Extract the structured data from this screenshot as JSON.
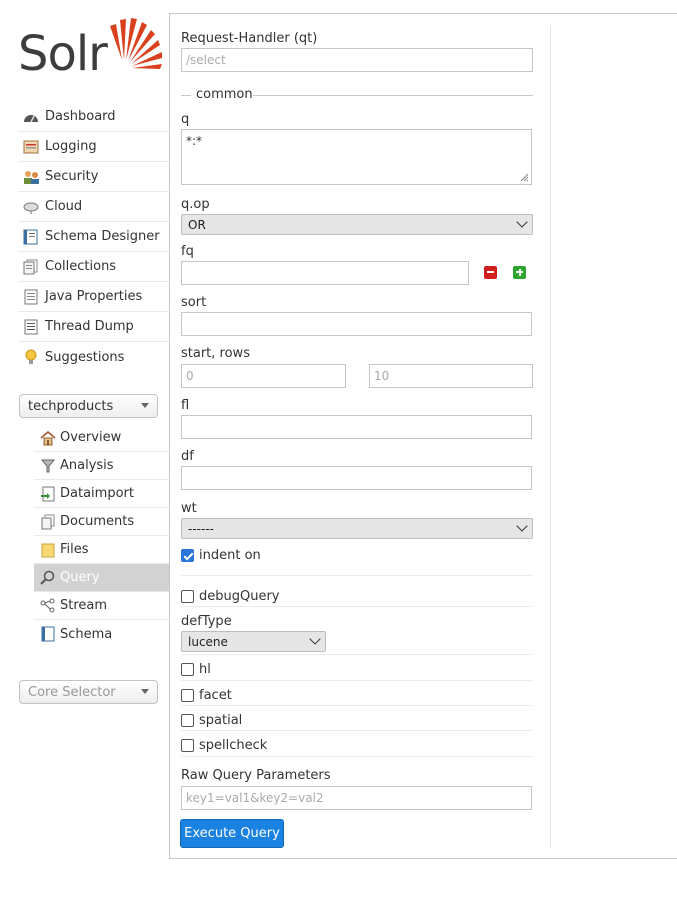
{
  "logo": {
    "text": "Solr"
  },
  "nav": [
    {
      "label": "Dashboard",
      "icon": "dashboard-icon"
    },
    {
      "label": "Logging",
      "icon": "logging-icon"
    },
    {
      "label": "Security",
      "icon": "security-icon"
    },
    {
      "label": "Cloud",
      "icon": "cloud-icon"
    },
    {
      "label": "Schema Designer",
      "icon": "schema-designer-icon"
    },
    {
      "label": "Collections",
      "icon": "collections-icon"
    },
    {
      "label": "Java Properties",
      "icon": "java-properties-icon"
    },
    {
      "label": "Thread Dump",
      "icon": "thread-dump-icon"
    },
    {
      "label": "Suggestions",
      "icon": "lightbulb-icon"
    }
  ],
  "core_dropdown": {
    "value": "techproducts"
  },
  "core_menu": [
    {
      "label": "Overview",
      "icon": "home-icon"
    },
    {
      "label": "Analysis",
      "icon": "funnel-icon"
    },
    {
      "label": "Dataimport",
      "icon": "dataimport-icon"
    },
    {
      "label": "Documents",
      "icon": "documents-icon"
    },
    {
      "label": "Files",
      "icon": "folder-icon"
    },
    {
      "label": "Query",
      "icon": "magnifier-icon",
      "active": true
    },
    {
      "label": "Stream",
      "icon": "stream-icon"
    },
    {
      "label": "Schema",
      "icon": "schema-icon"
    }
  ],
  "core_selector": {
    "placeholder": "Core Selector"
  },
  "form": {
    "request_handler_label": "Request-Handler (qt)",
    "request_handler_placeholder": "/select",
    "common_legend": "common",
    "q_label": "q",
    "q_value": "*:*",
    "qop_label": "q.op",
    "qop_value": "OR",
    "fq_label": "fq",
    "sort_label": "sort",
    "start_rows_label": "start, rows",
    "start_placeholder": "0",
    "rows_placeholder": "10",
    "fl_label": "fl",
    "df_label": "df",
    "wt_label": "wt",
    "wt_value": "------",
    "indent_label": "indent on",
    "indent_checked": true,
    "debugquery_label": "debugQuery",
    "deftype_label": "defType",
    "deftype_value": "lucene",
    "hl_label": "hl",
    "facet_label": "facet",
    "spatial_label": "spatial",
    "spellcheck_label": "spellcheck",
    "raw_label": "Raw Query Parameters",
    "raw_placeholder": "key1=val1&key2=val2",
    "execute_label": "Execute Query"
  },
  "colors": {
    "accent": "#1a82e0",
    "logo_red": "#d9411e",
    "remove_red": "#d11f1f",
    "add_green": "#2fa52f"
  }
}
